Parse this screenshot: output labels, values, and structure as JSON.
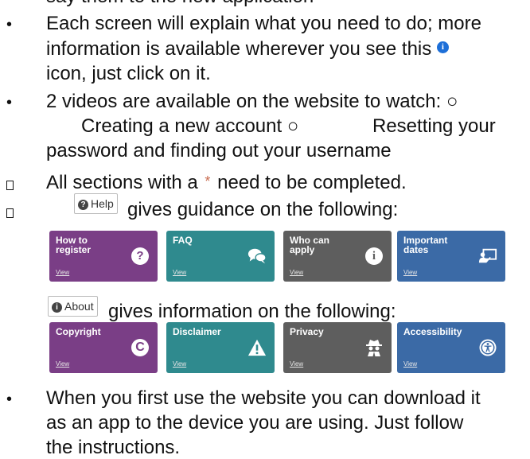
{
  "top_fragment": "say them to the new application",
  "paragraph1": {
    "line1": "Each screen will explain what you need to do; more",
    "line2_before": "information is available wherever you see this",
    "info_glyph": "i",
    "line3": "icon, just click on it."
  },
  "paragraph2": {
    "line1": "2 videos are available on the website to watch:  ○",
    "line2_a": "Creating a new account ○",
    "line2_b": "Resetting your",
    "line3": "password and finding out your username"
  },
  "paragraph3": {
    "before": "All sections with a",
    "asterisk": "*",
    "after": "need to be completed."
  },
  "help_section": {
    "button_label": "Help",
    "text": "gives guidance on the following:",
    "tiles": [
      {
        "title": "How to\nregister",
        "view": "View",
        "icon": "question-icon",
        "color": "#7a3e86"
      },
      {
        "title": "FAQ",
        "view": "View",
        "icon": "chat-bubbles-icon",
        "color": "#2f8a8e"
      },
      {
        "title": "Who can\napply",
        "view": "View",
        "icon": "info-icon",
        "color": "#5e5e5e"
      },
      {
        "title": "Important\ndates",
        "view": "View",
        "icon": "presentation-icon",
        "color": "#3b6aa6"
      }
    ]
  },
  "about_section": {
    "button_label": "About",
    "text": "gives information on the following:",
    "tiles": [
      {
        "title": "Copyright",
        "view": "View",
        "icon": "copyright-icon",
        "color": "#7a3e86"
      },
      {
        "title": "Disclaimer",
        "view": "View",
        "icon": "warning-icon",
        "color": "#2f8a8e"
      },
      {
        "title": "Privacy",
        "view": "View",
        "icon": "spy-icon",
        "color": "#5e5e5e"
      },
      {
        "title": "Accessibility",
        "view": "View",
        "icon": "accessibility-icon",
        "color": "#3b6aa6"
      }
    ]
  },
  "paragraph4": {
    "line1": "When you first use the website you can download it",
    "line2": "as an app to the device you are using. Just follow",
    "line3": "the instructions."
  }
}
